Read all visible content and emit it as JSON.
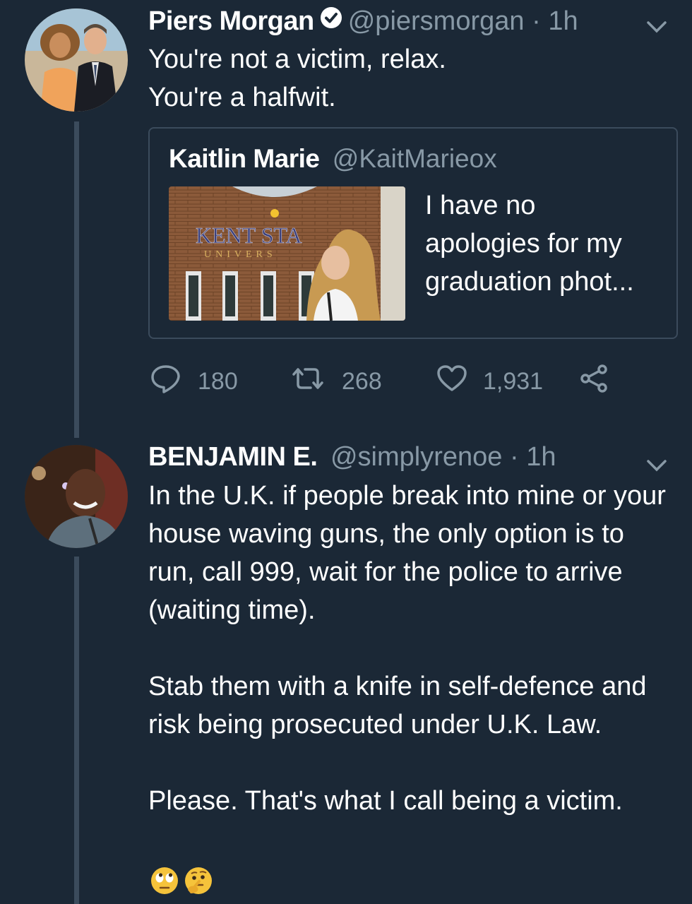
{
  "tweet1": {
    "author_name": "Piers Morgan",
    "handle": "@piersmorgan",
    "separator": "·",
    "time": "1h",
    "verified_icon": "verified-badge-icon",
    "lines": [
      "You're not a victim, relax.",
      "You're a halfwit."
    ],
    "quoted": {
      "author_name": "Kaitlin Marie",
      "handle": "@KaitMarieox",
      "text_lines": [
        "I have no",
        "apologies for my",
        "graduation phot..."
      ],
      "image": {
        "sign_line1": "KENT STA",
        "sign_line2": "UNIVERS"
      }
    },
    "actions": {
      "reply_icon": "reply-icon",
      "reply_count": "180",
      "retweet_icon": "retweet-icon",
      "retweet_count": "268",
      "like_icon": "heart-icon",
      "like_count": "1,931",
      "share_icon": "share-icon"
    }
  },
  "tweet2": {
    "author_name": "BENJAMIN E.",
    "handle": "@simplyrenoe",
    "separator": "·",
    "time": "1h",
    "paragraph1": "In the U.K. if people break into mine or your house waving guns, the only option is to run, call 999, wait for the police to arrive (waiting time).",
    "paragraph2": "Stab them with a knife in self-defence and risk being prosecuted under U.K. Law.",
    "paragraph3": "Please. That's what I call being a victim.",
    "emojis": [
      "face-with-rolling-eyes",
      "thinking-face"
    ]
  },
  "colors": {
    "background": "#1b2836",
    "secondary_text": "#8899a6",
    "thread_line": "#3b4b5c",
    "primary_text": "#ffffff"
  }
}
